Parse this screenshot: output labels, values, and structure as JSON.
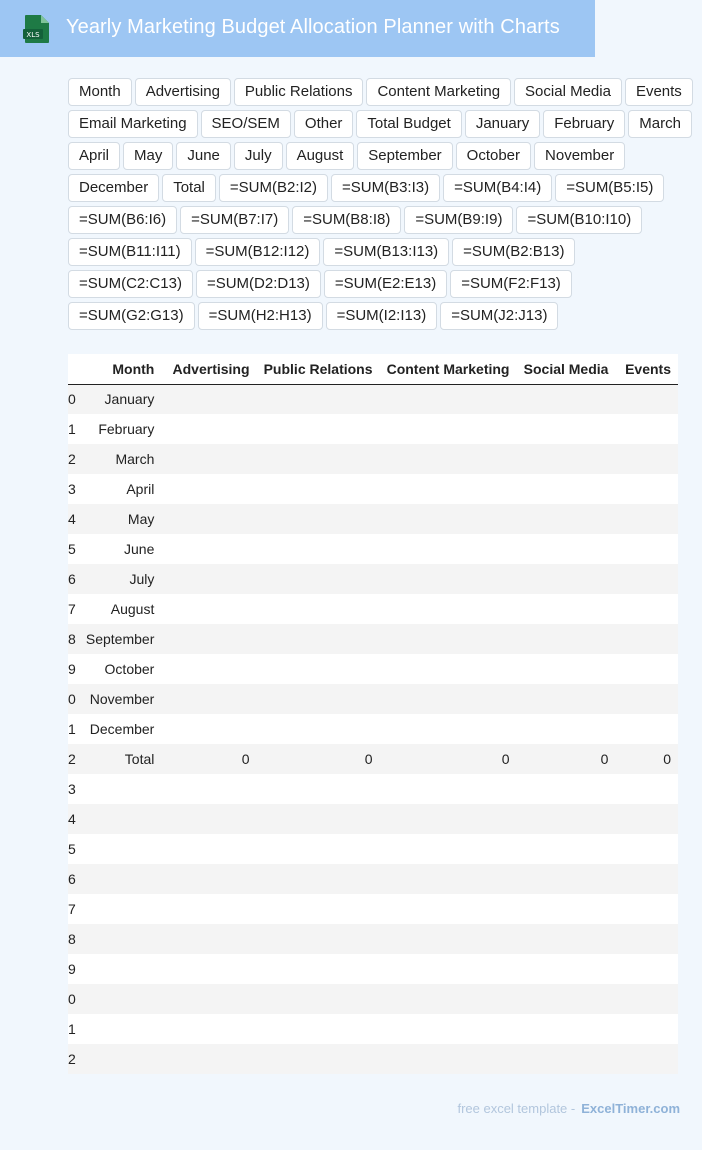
{
  "header": {
    "title": "Yearly Marketing Budget Allocation Planner with Charts",
    "icon_text": "XLS",
    "icon_color": "#1e7a45"
  },
  "chips": [
    "Month",
    "Advertising",
    "Public Relations",
    "Content Marketing",
    "Social Media",
    "Events",
    "Email Marketing",
    "SEO/SEM",
    "Other",
    "Total Budget",
    "January",
    "February",
    "March",
    "April",
    "May",
    "June",
    "July",
    "August",
    "September",
    "October",
    "November",
    "December",
    "Total",
    "=SUM(B2:I2)",
    "=SUM(B3:I3)",
    "=SUM(B4:I4)",
    "=SUM(B5:I5)",
    "=SUM(B6:I6)",
    "=SUM(B7:I7)",
    "=SUM(B8:I8)",
    "=SUM(B9:I9)",
    "=SUM(B10:I10)",
    "=SUM(B11:I11)",
    "=SUM(B12:I12)",
    "=SUM(B13:I13)",
    "=SUM(B2:B13)",
    "=SUM(C2:C13)",
    "=SUM(D2:D13)",
    "=SUM(E2:E13)",
    "=SUM(F2:F13)",
    "=SUM(G2:G13)",
    "=SUM(H2:H13)",
    "=SUM(I2:I13)",
    "=SUM(J2:J13)"
  ],
  "table": {
    "columns": [
      "Month",
      "Advertising",
      "Public Relations",
      "Content Marketing",
      "Social Media",
      "Events"
    ],
    "rows": [
      {
        "idx": "0",
        "cells": [
          "January",
          "",
          "",
          "",
          "",
          ""
        ]
      },
      {
        "idx": "1",
        "cells": [
          "February",
          "",
          "",
          "",
          "",
          ""
        ]
      },
      {
        "idx": "2",
        "cells": [
          "March",
          "",
          "",
          "",
          "",
          ""
        ]
      },
      {
        "idx": "3",
        "cells": [
          "April",
          "",
          "",
          "",
          "",
          ""
        ]
      },
      {
        "idx": "4",
        "cells": [
          "May",
          "",
          "",
          "",
          "",
          ""
        ]
      },
      {
        "idx": "5",
        "cells": [
          "June",
          "",
          "",
          "",
          "",
          ""
        ]
      },
      {
        "idx": "6",
        "cells": [
          "July",
          "",
          "",
          "",
          "",
          ""
        ]
      },
      {
        "idx": "7",
        "cells": [
          "August",
          "",
          "",
          "",
          "",
          ""
        ]
      },
      {
        "idx": "8",
        "cells": [
          "September",
          "",
          "",
          "",
          "",
          ""
        ]
      },
      {
        "idx": "9",
        "cells": [
          "October",
          "",
          "",
          "",
          "",
          ""
        ]
      },
      {
        "idx": "0",
        "cells": [
          "November",
          "",
          "",
          "",
          "",
          ""
        ]
      },
      {
        "idx": "1",
        "cells": [
          "December",
          "",
          "",
          "",
          "",
          ""
        ]
      },
      {
        "idx": "2",
        "cells": [
          "Total",
          "0",
          "0",
          "0",
          "0",
          "0"
        ]
      },
      {
        "idx": "3",
        "cells": [
          "",
          "",
          "",
          "",
          "",
          ""
        ]
      },
      {
        "idx": "4",
        "cells": [
          "",
          "",
          "",
          "",
          "",
          ""
        ]
      },
      {
        "idx": "5",
        "cells": [
          "",
          "",
          "",
          "",
          "",
          ""
        ]
      },
      {
        "idx": "6",
        "cells": [
          "",
          "",
          "",
          "",
          "",
          ""
        ]
      },
      {
        "idx": "7",
        "cells": [
          "",
          "",
          "",
          "",
          "",
          ""
        ]
      },
      {
        "idx": "8",
        "cells": [
          "",
          "",
          "",
          "",
          "",
          ""
        ]
      },
      {
        "idx": "9",
        "cells": [
          "",
          "",
          "",
          "",
          "",
          ""
        ]
      },
      {
        "idx": "0",
        "cells": [
          "",
          "",
          "",
          "",
          "",
          ""
        ]
      },
      {
        "idx": "1",
        "cells": [
          "",
          "",
          "",
          "",
          "",
          ""
        ]
      },
      {
        "idx": "2",
        "cells": [
          "",
          "",
          "",
          "",
          "",
          ""
        ]
      }
    ]
  },
  "footer": {
    "prefix": "free excel template -",
    "brand": "ExcelTimer.com"
  }
}
